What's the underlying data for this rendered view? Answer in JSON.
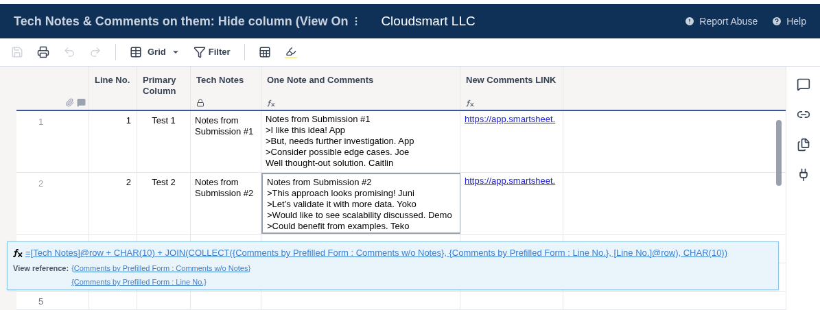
{
  "header": {
    "title": "Tech Notes & Comments on them: Hide column (View On",
    "company": "Cloudsmart LLC",
    "links": [
      "Report Abuse",
      "Help"
    ]
  },
  "toolbar": {
    "view": "Grid",
    "filter": "Filter"
  },
  "columns": [
    {
      "label": "Line No.",
      "kind": "plain"
    },
    {
      "label": "Primary Column",
      "kind": "plain"
    },
    {
      "label": "Tech Notes",
      "kind": "locked"
    },
    {
      "label": "One Note and Comments",
      "kind": "formula"
    },
    {
      "label": "New Comments LINK",
      "kind": "formula"
    }
  ],
  "rows": [
    {
      "number": "1",
      "line": "1",
      "primary": "Test 1",
      "tech": "Notes from Submission #1",
      "note": [
        "Notes from Submission #1",
        ">I like this idea! App",
        ">But, needs further investigation. App",
        ">Consider possible edge cases. Joe",
        "Well thought-out solution. Caitlin"
      ],
      "link": "https://app.smartsheet.",
      "selected": false
    },
    {
      "number": "2",
      "line": "2",
      "primary": "Test 2",
      "tech": "Notes from Submission #2",
      "note": [
        "Notes from Submission #2",
        ">This approach looks promising! Juni",
        ">Let’s validate it with more data. Yoko",
        ">Would like to see scalability discussed. Demo",
        ">Could benefit from examples. Teko"
      ],
      "link": "https://app.smartsheet.",
      "selected": true
    }
  ],
  "last_row": {
    "number": "5"
  },
  "formula_popup": {
    "formula": "=[Tech Notes]@row + CHAR(10) + JOIN(COLLECT({Comments by Prefilled Form : Comments w/o Notes}, {Comments by Prefilled Form : Line No.}, [Line No.]@row), CHAR(10))",
    "reference_label": "View reference:",
    "references": [
      "{Comments by Prefilled Form : Comments w/o Notes}",
      "{Comments by Prefilled Form : Line No.}"
    ]
  }
}
